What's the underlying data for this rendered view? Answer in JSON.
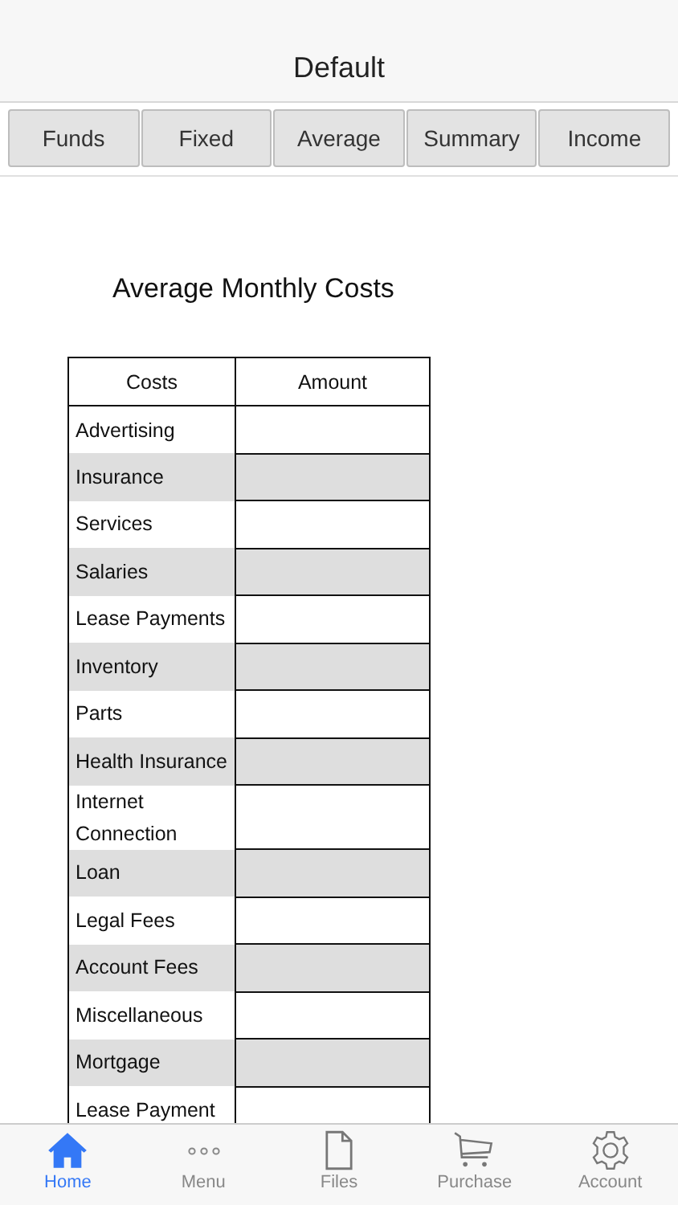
{
  "header": {
    "title": "Default"
  },
  "tabs": [
    {
      "label": "Funds",
      "selected": false
    },
    {
      "label": "Fixed",
      "selected": false
    },
    {
      "label": "Average",
      "selected": false
    },
    {
      "label": "Summary",
      "selected": false
    },
    {
      "label": "Income",
      "selected": false
    }
  ],
  "heading": "Average Monthly Costs",
  "table": {
    "columns": [
      "Costs",
      "Amount"
    ],
    "rows": [
      {
        "cost": "Advertising"
      },
      {
        "cost": "Insurance"
      },
      {
        "cost": "Services"
      },
      {
        "cost": "Salaries"
      },
      {
        "cost": "Lease Payments"
      },
      {
        "cost": "Inventory"
      },
      {
        "cost": "Parts"
      },
      {
        "cost": "Health Insurance"
      },
      {
        "cost": "Internet Connection"
      },
      {
        "cost": "Loan"
      },
      {
        "cost": "Legal Fees"
      },
      {
        "cost": "Account Fees"
      },
      {
        "cost": "Miscellaneous"
      },
      {
        "cost": "Mortgage"
      },
      {
        "cost": "Lease Payment"
      }
    ]
  },
  "tab_bar": [
    {
      "label": "Home",
      "kind": "home",
      "selected": true
    },
    {
      "label": "Menu",
      "kind": "dots",
      "selected": false
    },
    {
      "label": "Files",
      "kind": "file",
      "selected": false
    },
    {
      "label": "Purchase",
      "kind": "cart",
      "selected": false
    },
    {
      "label": "Account",
      "kind": "gear",
      "selected": false
    }
  ]
}
